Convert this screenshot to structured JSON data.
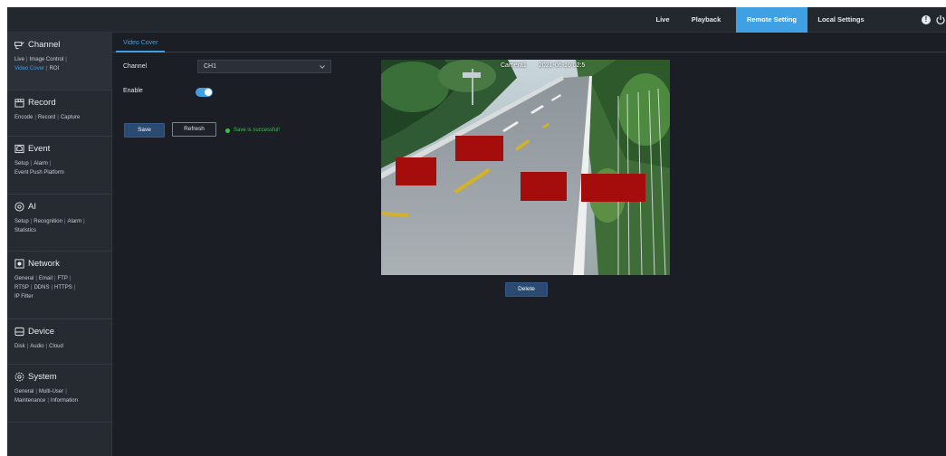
{
  "topbar": {
    "nav": [
      {
        "label": "Live",
        "active": false
      },
      {
        "label": "Playback",
        "active": false
      },
      {
        "label": "Remote Setting",
        "active": true
      },
      {
        "label": "Local Settings",
        "active": false
      }
    ],
    "icons": [
      "info-icon",
      "power-icon"
    ]
  },
  "sidebar": {
    "sections": [
      {
        "title": "Channel",
        "icon": "camera-icon",
        "active": true,
        "links": [
          [
            "Live",
            "Image Control"
          ],
          [
            "Video Cover",
            "ROI"
          ]
        ],
        "active_link": "Video Cover"
      },
      {
        "title": "Record",
        "icon": "record-icon",
        "links": [
          [
            "Encode",
            "Record",
            "Capture"
          ]
        ]
      },
      {
        "title": "Event",
        "icon": "event-icon",
        "links": [
          [
            "Setup",
            "Alarm"
          ],
          [
            "Event Push Platform"
          ]
        ]
      },
      {
        "title": "AI",
        "icon": "ai-icon",
        "links": [
          [
            "Setup",
            "Recognition",
            "Alarm"
          ],
          [
            "Statistics"
          ]
        ]
      },
      {
        "title": "Network",
        "icon": "network-icon",
        "links": [
          [
            "General",
            "Email",
            "FTP"
          ],
          [
            "RTSP",
            "DDNS",
            "HTTPS"
          ],
          [
            "IP Filter"
          ]
        ]
      },
      {
        "title": "Device",
        "icon": "device-icon",
        "links": [
          [
            "Disk",
            "Audio",
            "Cloud"
          ]
        ]
      },
      {
        "title": "System",
        "icon": "system-icon",
        "links": [
          [
            "General",
            "Multi-User"
          ],
          [
            "Maintenance",
            "Information"
          ]
        ]
      }
    ]
  },
  "content": {
    "tab": "Video Cover",
    "channel_label": "Channel",
    "channel_value": "CH1",
    "enable_label": "Enable",
    "enable_on": true,
    "save_label": "Save",
    "refresh_label": "Refresh",
    "status_text": "Save is successful!",
    "preview": {
      "camera_name": "Camera1",
      "timestamp": "2021-06-16 02:5",
      "mask_color": "#a50d0d",
      "mask_count": 4
    },
    "delete_label": "Delete"
  },
  "colors": {
    "accent": "#3fa0e4",
    "background": "#1b1e24",
    "success": "#3cc24a"
  }
}
